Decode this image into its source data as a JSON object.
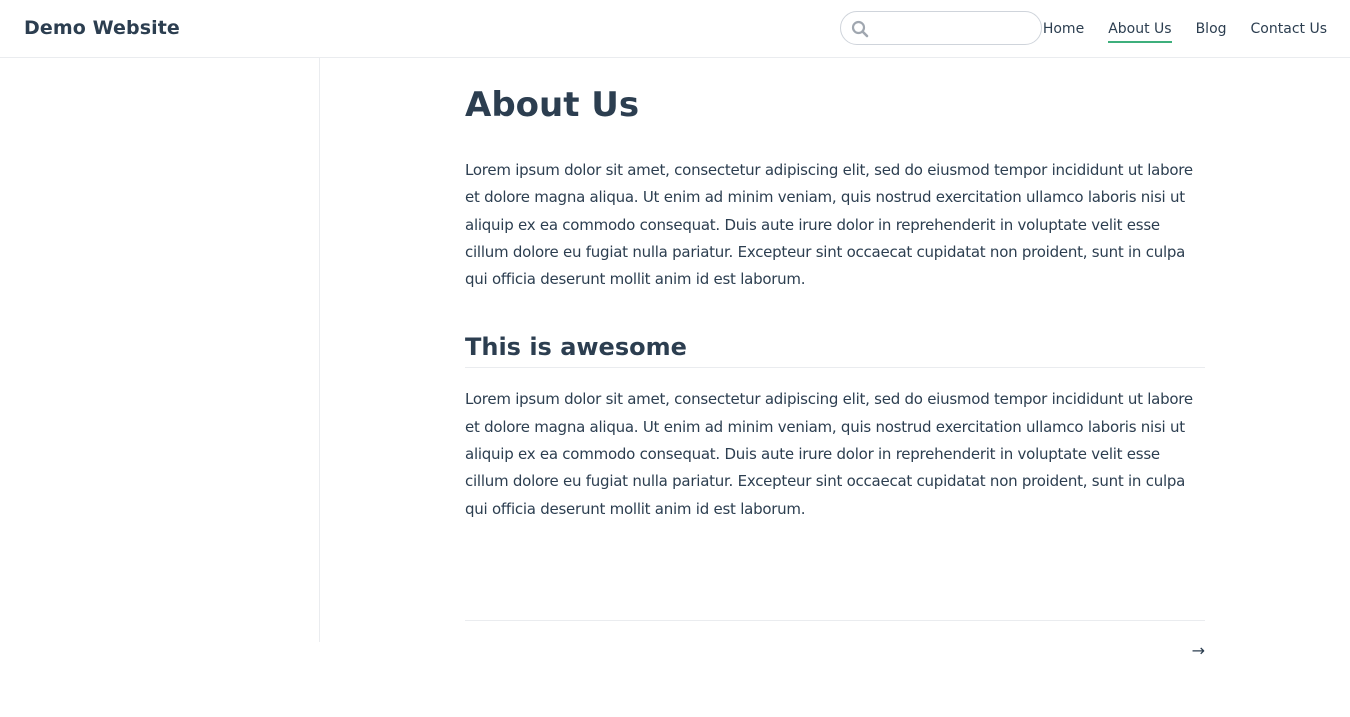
{
  "navbar": {
    "site_name": "Demo Website",
    "search": {
      "placeholder": "",
      "value": "",
      "icon": "search-icon"
    },
    "links": [
      {
        "label": "Home",
        "active": false
      },
      {
        "label": "About Us",
        "active": true
      },
      {
        "label": "Blog",
        "active": false
      },
      {
        "label": "Contact Us",
        "active": false
      }
    ],
    "accent_color": "#3eaf7c"
  },
  "content": {
    "title": "About Us",
    "paragraph_1": "Lorem ipsum dolor sit amet, consectetur adipiscing elit, sed do eiusmod tempor incididunt ut labore et dolore magna aliqua. Ut enim ad minim veniam, quis nostrud exercitation ullamco laboris nisi ut aliquip ex ea commodo consequat. Duis aute irure dolor in reprehenderit in voluptate velit esse cillum dolore eu fugiat nulla pariatur. Excepteur sint occaecat cupidatat non proident, sunt in culpa qui officia deserunt mollit anim id est laborum.",
    "section_title": "This is awesome",
    "paragraph_2": "Lorem ipsum dolor sit amet, consectetur adipiscing elit, sed do eiusmod tempor incididunt ut labore et dolore magna aliqua. Ut enim ad minim veniam, quis nostrud exercitation ullamco laboris nisi ut aliquip ex ea commodo consequat. Duis aute irure dolor in reprehenderit in voluptate velit esse cillum dolore eu fugiat nulla pariatur. Excepteur sint occaecat cupidatat non proident, sunt in culpa qui officia deserunt mollit anim id est laborum."
  },
  "footer": {
    "next_link": "→"
  }
}
